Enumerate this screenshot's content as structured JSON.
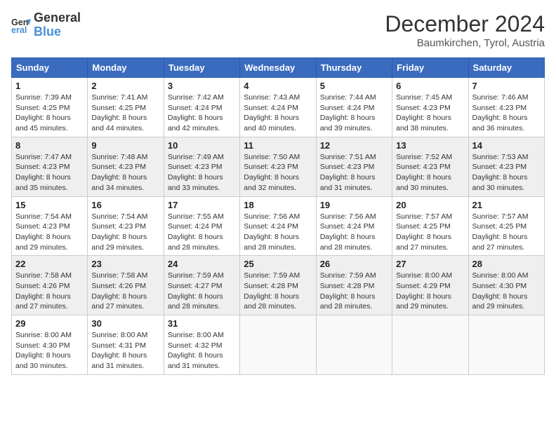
{
  "header": {
    "logo_line1": "General",
    "logo_line2": "Blue",
    "month": "December 2024",
    "location": "Baumkirchen, Tyrol, Austria"
  },
  "weekdays": [
    "Sunday",
    "Monday",
    "Tuesday",
    "Wednesday",
    "Thursday",
    "Friday",
    "Saturday"
  ],
  "weeks": [
    [
      {
        "day": "1",
        "sunrise": "Sunrise: 7:39 AM",
        "sunset": "Sunset: 4:25 PM",
        "daylight": "Daylight: 8 hours and 45 minutes."
      },
      {
        "day": "2",
        "sunrise": "Sunrise: 7:41 AM",
        "sunset": "Sunset: 4:25 PM",
        "daylight": "Daylight: 8 hours and 44 minutes."
      },
      {
        "day": "3",
        "sunrise": "Sunrise: 7:42 AM",
        "sunset": "Sunset: 4:24 PM",
        "daylight": "Daylight: 8 hours and 42 minutes."
      },
      {
        "day": "4",
        "sunrise": "Sunrise: 7:43 AM",
        "sunset": "Sunset: 4:24 PM",
        "daylight": "Daylight: 8 hours and 40 minutes."
      },
      {
        "day": "5",
        "sunrise": "Sunrise: 7:44 AM",
        "sunset": "Sunset: 4:24 PM",
        "daylight": "Daylight: 8 hours and 39 minutes."
      },
      {
        "day": "6",
        "sunrise": "Sunrise: 7:45 AM",
        "sunset": "Sunset: 4:23 PM",
        "daylight": "Daylight: 8 hours and 38 minutes."
      },
      {
        "day": "7",
        "sunrise": "Sunrise: 7:46 AM",
        "sunset": "Sunset: 4:23 PM",
        "daylight": "Daylight: 8 hours and 36 minutes."
      }
    ],
    [
      {
        "day": "8",
        "sunrise": "Sunrise: 7:47 AM",
        "sunset": "Sunset: 4:23 PM",
        "daylight": "Daylight: 8 hours and 35 minutes."
      },
      {
        "day": "9",
        "sunrise": "Sunrise: 7:48 AM",
        "sunset": "Sunset: 4:23 PM",
        "daylight": "Daylight: 8 hours and 34 minutes."
      },
      {
        "day": "10",
        "sunrise": "Sunrise: 7:49 AM",
        "sunset": "Sunset: 4:23 PM",
        "daylight": "Daylight: 8 hours and 33 minutes."
      },
      {
        "day": "11",
        "sunrise": "Sunrise: 7:50 AM",
        "sunset": "Sunset: 4:23 PM",
        "daylight": "Daylight: 8 hours and 32 minutes."
      },
      {
        "day": "12",
        "sunrise": "Sunrise: 7:51 AM",
        "sunset": "Sunset: 4:23 PM",
        "daylight": "Daylight: 8 hours and 31 minutes."
      },
      {
        "day": "13",
        "sunrise": "Sunrise: 7:52 AM",
        "sunset": "Sunset: 4:23 PM",
        "daylight": "Daylight: 8 hours and 30 minutes."
      },
      {
        "day": "14",
        "sunrise": "Sunrise: 7:53 AM",
        "sunset": "Sunset: 4:23 PM",
        "daylight": "Daylight: 8 hours and 30 minutes."
      }
    ],
    [
      {
        "day": "15",
        "sunrise": "Sunrise: 7:54 AM",
        "sunset": "Sunset: 4:23 PM",
        "daylight": "Daylight: 8 hours and 29 minutes."
      },
      {
        "day": "16",
        "sunrise": "Sunrise: 7:54 AM",
        "sunset": "Sunset: 4:23 PM",
        "daylight": "Daylight: 8 hours and 29 minutes."
      },
      {
        "day": "17",
        "sunrise": "Sunrise: 7:55 AM",
        "sunset": "Sunset: 4:24 PM",
        "daylight": "Daylight: 8 hours and 28 minutes."
      },
      {
        "day": "18",
        "sunrise": "Sunrise: 7:56 AM",
        "sunset": "Sunset: 4:24 PM",
        "daylight": "Daylight: 8 hours and 28 minutes."
      },
      {
        "day": "19",
        "sunrise": "Sunrise: 7:56 AM",
        "sunset": "Sunset: 4:24 PM",
        "daylight": "Daylight: 8 hours and 28 minutes."
      },
      {
        "day": "20",
        "sunrise": "Sunrise: 7:57 AM",
        "sunset": "Sunset: 4:25 PM",
        "daylight": "Daylight: 8 hours and 27 minutes."
      },
      {
        "day": "21",
        "sunrise": "Sunrise: 7:57 AM",
        "sunset": "Sunset: 4:25 PM",
        "daylight": "Daylight: 8 hours and 27 minutes."
      }
    ],
    [
      {
        "day": "22",
        "sunrise": "Sunrise: 7:58 AM",
        "sunset": "Sunset: 4:26 PM",
        "daylight": "Daylight: 8 hours and 27 minutes."
      },
      {
        "day": "23",
        "sunrise": "Sunrise: 7:58 AM",
        "sunset": "Sunset: 4:26 PM",
        "daylight": "Daylight: 8 hours and 27 minutes."
      },
      {
        "day": "24",
        "sunrise": "Sunrise: 7:59 AM",
        "sunset": "Sunset: 4:27 PM",
        "daylight": "Daylight: 8 hours and 28 minutes."
      },
      {
        "day": "25",
        "sunrise": "Sunrise: 7:59 AM",
        "sunset": "Sunset: 4:28 PM",
        "daylight": "Daylight: 8 hours and 28 minutes."
      },
      {
        "day": "26",
        "sunrise": "Sunrise: 7:59 AM",
        "sunset": "Sunset: 4:28 PM",
        "daylight": "Daylight: 8 hours and 28 minutes."
      },
      {
        "day": "27",
        "sunrise": "Sunrise: 8:00 AM",
        "sunset": "Sunset: 4:29 PM",
        "daylight": "Daylight: 8 hours and 29 minutes."
      },
      {
        "day": "28",
        "sunrise": "Sunrise: 8:00 AM",
        "sunset": "Sunset: 4:30 PM",
        "daylight": "Daylight: 8 hours and 29 minutes."
      }
    ],
    [
      {
        "day": "29",
        "sunrise": "Sunrise: 8:00 AM",
        "sunset": "Sunset: 4:30 PM",
        "daylight": "Daylight: 8 hours and 30 minutes."
      },
      {
        "day": "30",
        "sunrise": "Sunrise: 8:00 AM",
        "sunset": "Sunset: 4:31 PM",
        "daylight": "Daylight: 8 hours and 31 minutes."
      },
      {
        "day": "31",
        "sunrise": "Sunrise: 8:00 AM",
        "sunset": "Sunset: 4:32 PM",
        "daylight": "Daylight: 8 hours and 31 minutes."
      },
      null,
      null,
      null,
      null
    ]
  ]
}
